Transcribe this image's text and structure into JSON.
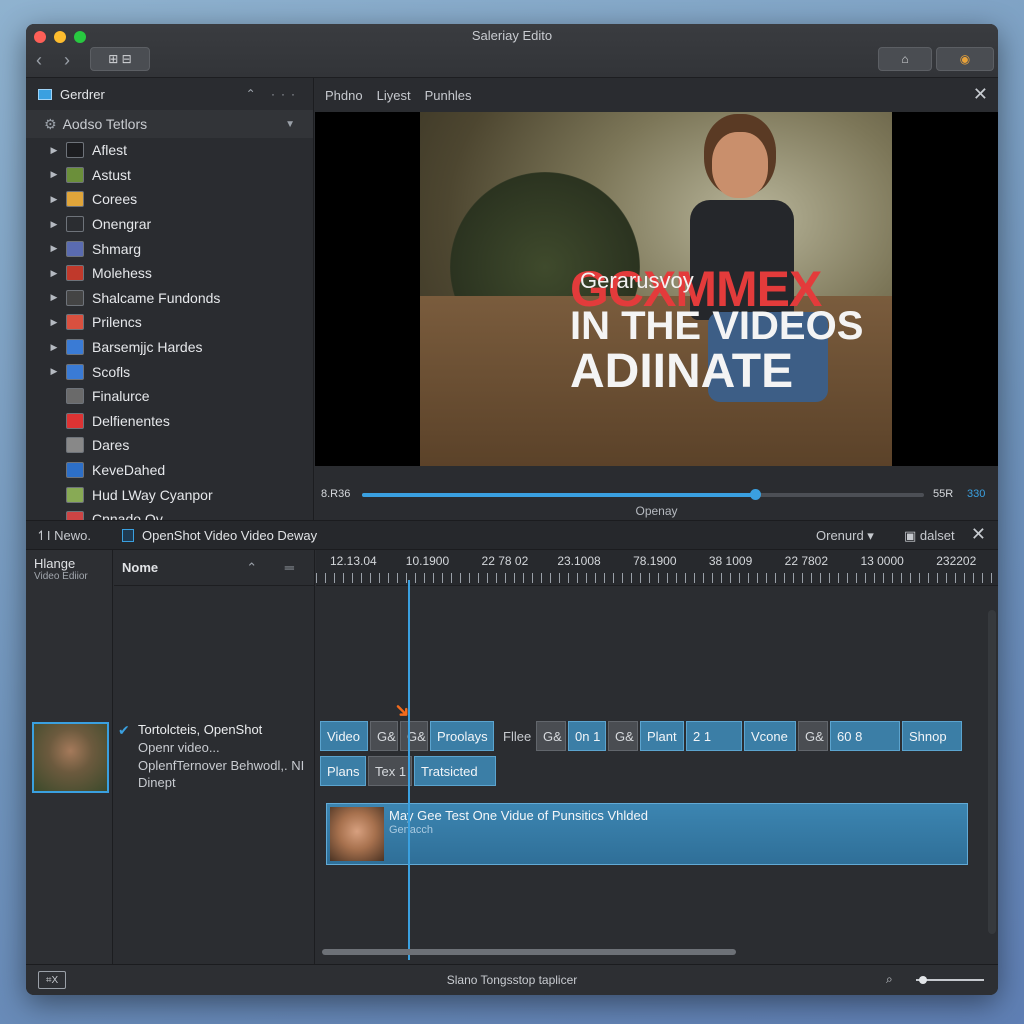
{
  "window": {
    "title": "Saleriay Edito"
  },
  "toolbar": {
    "nav_back": "‹",
    "nav_forward": "›",
    "view_btn": "⊞ ⊟",
    "home_btn": "⌂",
    "record_btn": "◉"
  },
  "browser": {
    "title": "Gerdrer",
    "controls": "⌃ ···",
    "group": "Aodso Tetlors",
    "items": [
      {
        "label": "Aflest",
        "expandable": true
      },
      {
        "label": "Astust",
        "expandable": true
      },
      {
        "label": "Corees",
        "expandable": true
      },
      {
        "label": "Onengrar",
        "expandable": true
      },
      {
        "label": "Shmarg",
        "expandable": true
      },
      {
        "label": "Molehess",
        "expandable": true
      },
      {
        "label": "Shalcame Fundonds",
        "expandable": true
      },
      {
        "label": "Prilencs",
        "expandable": true
      },
      {
        "label": "Barsemjjc Hardes",
        "expandable": true
      },
      {
        "label": "Scofls",
        "expandable": true
      },
      {
        "label": "Finalurce",
        "expandable": false
      },
      {
        "label": "Delfienentes",
        "expandable": false
      },
      {
        "label": "Dares",
        "expandable": false
      },
      {
        "label": "KeveDahed",
        "expandable": false
      },
      {
        "label": "Hud LWay Cyanpor",
        "expandable": false
      },
      {
        "label": "Cnnado Ov",
        "expandable": false
      }
    ]
  },
  "preview": {
    "tabs": [
      "Phdno",
      "Liyest",
      "Punhles"
    ],
    "overlay_line1": "GCXMMEX",
    "overlay_line1_small": "Gerarusvoy",
    "overlay_line2": "IN THE VIDEOS",
    "overlay_line3": "ADIINATE",
    "time_left": "8.R36",
    "time_right": "55R",
    "time_blue": "330",
    "progress": 0.7,
    "caption": "Openay"
  },
  "timeline": {
    "left_tab": "↿I Newo.",
    "title": "OpenShot Video Video Deway",
    "orient_label": "Orenurd ▾",
    "view_label": "▣ dalset",
    "close": "✕",
    "col_a_title": "Hlange",
    "col_a_sub": "Video Ediior",
    "name_header": "Nome",
    "name_header_ctrls": "⌃ ═",
    "item_title": "Tortolcteis, OpenShot",
    "item_line2": "Openr video...",
    "item_line3": "OplenfTernover Behwodl,. NI",
    "item_line4": "Dinept",
    "ruler_labels": [
      "12.13.04",
      "10.1900",
      "22 78 02",
      "23.1008",
      "78.1900",
      "38 1009",
      "22 7802",
      "13 0000",
      "232202"
    ],
    "row1": [
      {
        "label": "Video",
        "w": 48,
        "dark": false
      },
      {
        "label": "G&",
        "w": 28,
        "dark": true
      },
      {
        "label": "G&",
        "w": 28,
        "dark": true
      },
      {
        "label": "Proolays",
        "w": 64,
        "dark": false
      },
      {
        "label": "Fllee",
        "w": 38,
        "dark": false,
        "plain": true
      },
      {
        "label": "G&",
        "w": 30,
        "dark": true
      },
      {
        "label": "0n 1",
        "w": 38,
        "dark": false
      },
      {
        "label": "G&",
        "w": 30,
        "dark": true
      },
      {
        "label": "Plant",
        "w": 44,
        "dark": false
      },
      {
        "label": "2       1",
        "w": 56,
        "dark": false
      },
      {
        "label": "Vcone",
        "w": 52,
        "dark": false
      },
      {
        "label": "G&",
        "w": 30,
        "dark": true
      },
      {
        "label": "60       8",
        "w": 70,
        "dark": false
      },
      {
        "label": "Shnop",
        "w": 60,
        "dark": false
      }
    ],
    "row2": [
      {
        "label": "Plans",
        "w": 46,
        "dark": false
      },
      {
        "label": "Tex 1",
        "w": 44,
        "dark": true
      },
      {
        "label": "Tratsicted",
        "w": 82,
        "dark": false
      }
    ],
    "long_clip_title": "May Gee Test One Vidue of Punsitics Vhlded",
    "long_clip_sub": "Genacch"
  },
  "status": {
    "icon_label": "⌗X",
    "message": "Slano Tongsstop taplicer",
    "zoom_icon": "⌕",
    "zoom_level": 0.05
  },
  "colors": {
    "accent": "#3aa0e0",
    "clip": "#3b7ea6",
    "playhead_arrow": "#f26b1d"
  }
}
